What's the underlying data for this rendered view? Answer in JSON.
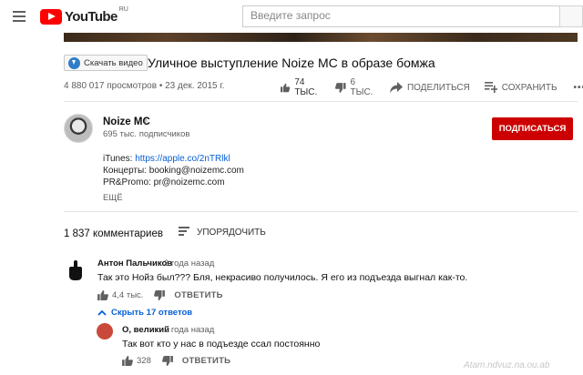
{
  "header": {
    "logo_text": "YouTube",
    "logo_region": "RU",
    "search_placeholder": "Введите запрос"
  },
  "video": {
    "download_badge": "Скачать видео",
    "title": "Уличное выступление Noize MC в образе бомжа",
    "views_date": "4 880 017 просмотров • 23 дек. 2015 г.",
    "likes": "74 ТЫС.",
    "dislikes": "6 ТЫС.",
    "share_label": "ПОДЕЛИТЬСЯ",
    "save_label": "СОХРАНИТЬ",
    "more_label": "•••"
  },
  "channel": {
    "name": "Noize MC",
    "name_note": "♪",
    "subscribers": "695 тыс. подписчиков",
    "subscribe_label": "ПОДПИСАТЬСЯ",
    "description": {
      "itunes_label": "iTunes: ",
      "itunes_link": "https://apple.co/2nTRlkl",
      "concerts": "Концерты: booking@noizemc.com",
      "promo": "PR&Promo: pr@noizemc.com"
    },
    "more_label": "ЕЩЁ"
  },
  "comments": {
    "count_label": "1 837 комментариев",
    "sort_label": "УПОРЯДОЧИТЬ",
    "items": [
      {
        "author": "Антон Пальчиков",
        "time": "3 года назад",
        "text": "Так это Нойз был??? Бля, некрасиво получилось. Я его из подъезда выгнал как-то.",
        "likes": "4,4 тыс.",
        "reply_label": "ОТВЕТИТЬ",
        "replies_toggle": "Скрыть 17 ответов"
      }
    ],
    "replies": [
      {
        "author": "О, великий",
        "time": "2 года назад",
        "text": "Так вот кто у нас в подъезде ссал постоянно",
        "likes": "328",
        "reply_label": "ОТВЕТИТЬ"
      }
    ]
  },
  "watermark": "Atam.ndvuz.na.ou.ab",
  "colors": {
    "accent_red": "#cc0000",
    "link_blue": "#065fd4",
    "muted_gray": "#606060"
  }
}
